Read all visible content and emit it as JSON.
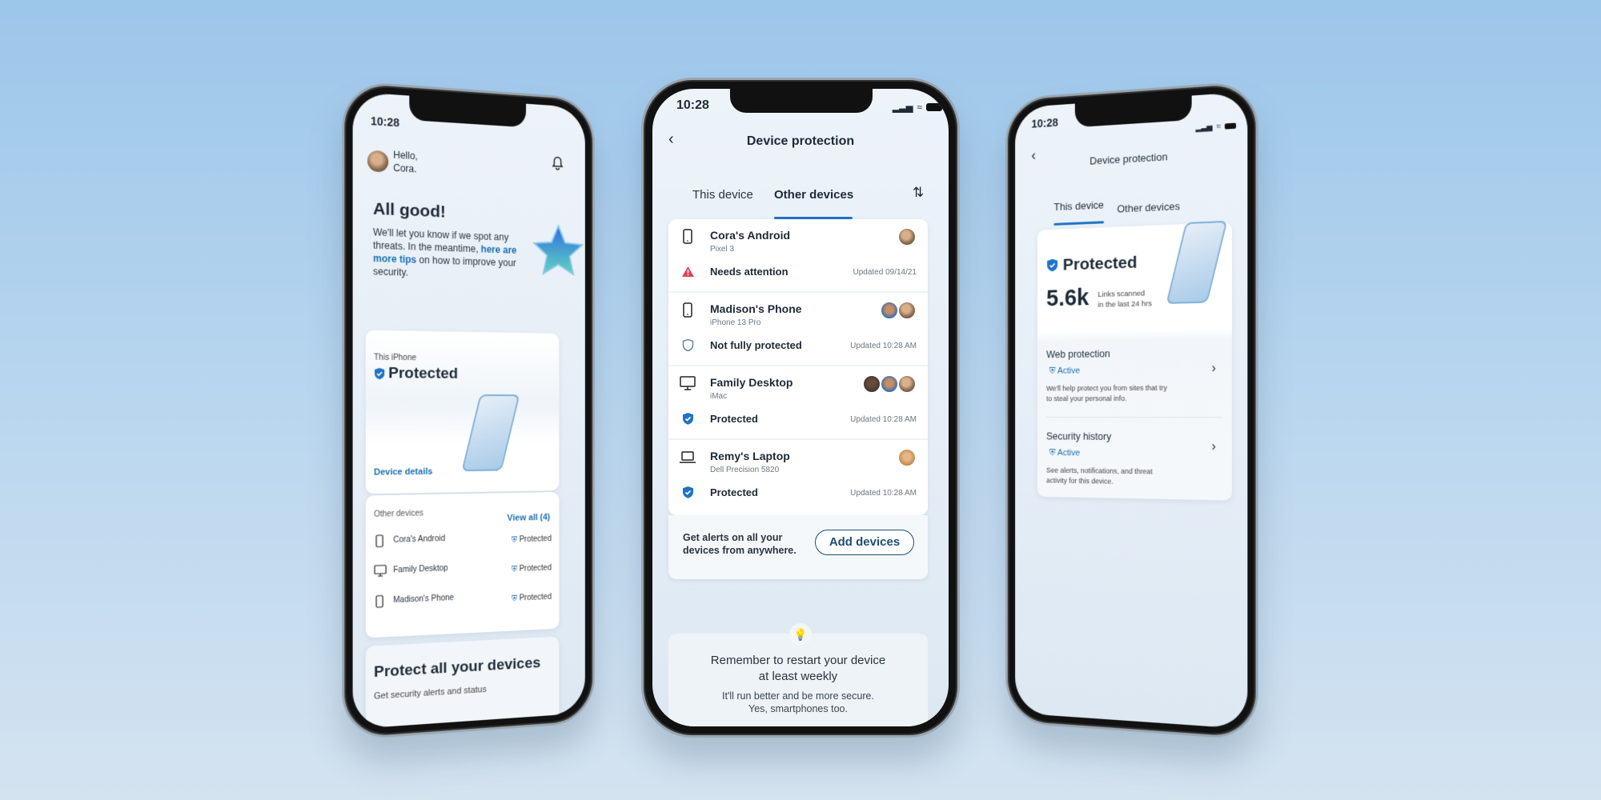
{
  "colors": {
    "accent": "#1f73c4",
    "warning": "#e0415a",
    "background": "#a9cdee"
  },
  "left_phone": {
    "time": "10:28",
    "greeting": "Hello,",
    "user": "Cora.",
    "bell_icon": "bell-icon",
    "headline": "All good!",
    "message_before": "We'll let you know if we spot any threats. In the meantime,",
    "message_link": "here are more tips",
    "message_after": "on how to improve your security.",
    "this_iphone_label": "This iPhone",
    "this_iphone_status": "Protected",
    "device_details_link": "Device details",
    "other_devices_label": "Other devices",
    "view_all_link": "View all (4)",
    "other_devices": [
      {
        "name": "Cora's Android",
        "icon": "phone-icon",
        "status": "Protected"
      },
      {
        "name": "Family Desktop",
        "icon": "desktop-icon",
        "status": "Protected"
      },
      {
        "name": "Madison's Phone",
        "icon": "phone-icon",
        "status": "Protected"
      }
    ],
    "promo_title": "Protect all your devices",
    "promo_subtitle": "Get security alerts and status"
  },
  "center_phone": {
    "time": "10:28",
    "title": "Device protection",
    "tabs": [
      "This device",
      "Other devices"
    ],
    "active_tab": "Other devices",
    "devices": [
      {
        "name": "Cora's Android",
        "model": "Pixel 3",
        "icon": "phone-icon",
        "status": "Needs attention",
        "status_icon": "warning-icon",
        "updated": "Updated 09/14/21",
        "avatars": 1
      },
      {
        "name": "Madison's Phone",
        "model": "iPhone 13 Pro",
        "icon": "phone-icon",
        "status": "Not fully protected",
        "status_icon": "shield-outline-icon",
        "updated": "Updated 10:28 AM",
        "avatars": 2
      },
      {
        "name": "Family Desktop",
        "model": "iMac",
        "icon": "desktop-icon",
        "status": "Protected",
        "status_icon": "shield-check-icon",
        "updated": "Updated 10:28 AM",
        "avatars": 3
      },
      {
        "name": "Remy's Laptop",
        "model": "Dell Precision 5820",
        "icon": "laptop-icon",
        "status": "Protected",
        "status_icon": "shield-check-icon",
        "updated": "Updated 10:28 AM",
        "avatars": 1
      }
    ],
    "alerts_text_1": "Get alerts on all your",
    "alerts_text_2": "devices from anywhere.",
    "add_devices_button": "Add devices",
    "tip_title_1": "Remember to restart your device",
    "tip_title_2": "at least weekly",
    "tip_body_1": "It'll run better and be more secure.",
    "tip_body_2": "Yes, smartphones too."
  },
  "right_phone": {
    "time": "10:28",
    "title": "Device protection",
    "tabs": [
      "This device",
      "Other devices"
    ],
    "active_tab": "This device",
    "status": "Protected",
    "links_count": "5.6k",
    "links_label_1": "Links scanned",
    "links_label_2": "in the last 24 hrs",
    "sections": [
      {
        "title": "Web protection",
        "status": "Active",
        "desc_1": "We'll help protect you from sites that try",
        "desc_2": "to steal your personal info."
      },
      {
        "title": "Security history",
        "status": "Active",
        "desc_1": "See alerts, notifications, and threat",
        "desc_2": "activity for this device."
      }
    ]
  }
}
